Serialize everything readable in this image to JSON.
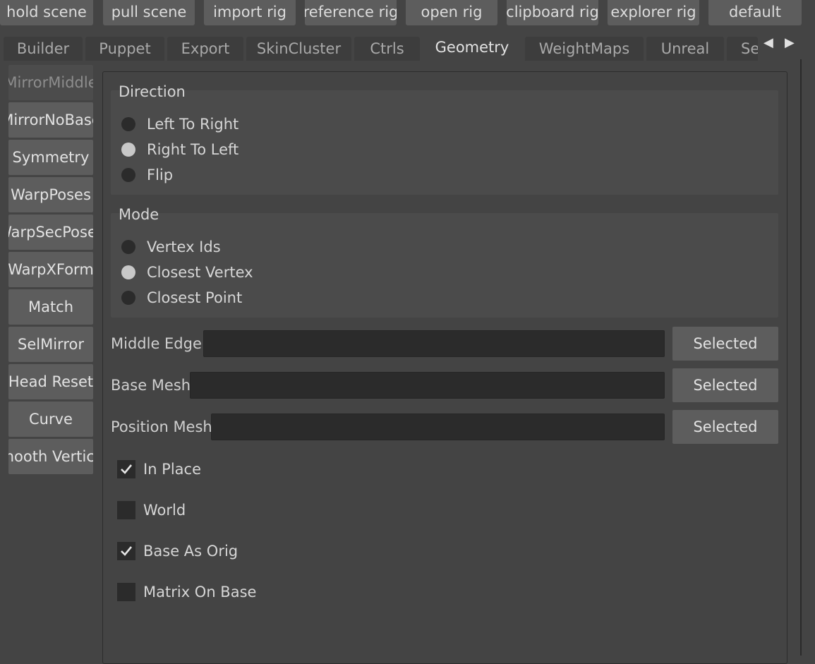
{
  "toolbar": {
    "buttons": [
      "hold scene",
      "pull scene",
      "import rig",
      "reference rig",
      "open rig",
      "clipboard rig",
      "explorer rig",
      "default"
    ]
  },
  "tabs": {
    "items": [
      "Builder",
      "Puppet",
      "Export",
      "SkinCluster",
      "Ctrls",
      "Geometry",
      "WeightMaps",
      "Unreal",
      "Se"
    ],
    "active": "Geometry"
  },
  "sidebar": {
    "items": [
      "MirrorMiddle",
      "MirrorNoBase",
      "Symmetry",
      "WarpPoses",
      "WarpSecPoses",
      "WarpXForm",
      "Match",
      "SelMirror",
      "Head Reset",
      "Curve",
      "Smooth Vertices"
    ]
  },
  "direction": {
    "title": "Direction",
    "options": [
      "Left To Right",
      "Right To Left",
      "Flip"
    ],
    "selected": "Right To Left"
  },
  "mode": {
    "title": "Mode",
    "options": [
      "Vertex Ids",
      "Closest Vertex",
      "Closest Point"
    ],
    "selected": "Closest Vertex"
  },
  "fields": {
    "middle_edge": {
      "label": "Middle Edge",
      "value": "",
      "button": "Selected"
    },
    "base_mesh": {
      "label": "Base Mesh",
      "value": "",
      "button": "Selected"
    },
    "position_mesh": {
      "label": "Position Mesh",
      "value": "",
      "button": "Selected"
    }
  },
  "checkboxes": {
    "in_place": {
      "label": "In Place",
      "checked": true
    },
    "world": {
      "label": "World",
      "checked": false
    },
    "base_as_orig": {
      "label": "Base As Orig",
      "checked": true
    },
    "matrix_on_base": {
      "label": "Matrix On Base",
      "checked": false
    }
  },
  "colors": {
    "background": "#444444",
    "button": "#5d5d5d",
    "field": "#2b2b2b",
    "group": "#4b4b4b"
  }
}
